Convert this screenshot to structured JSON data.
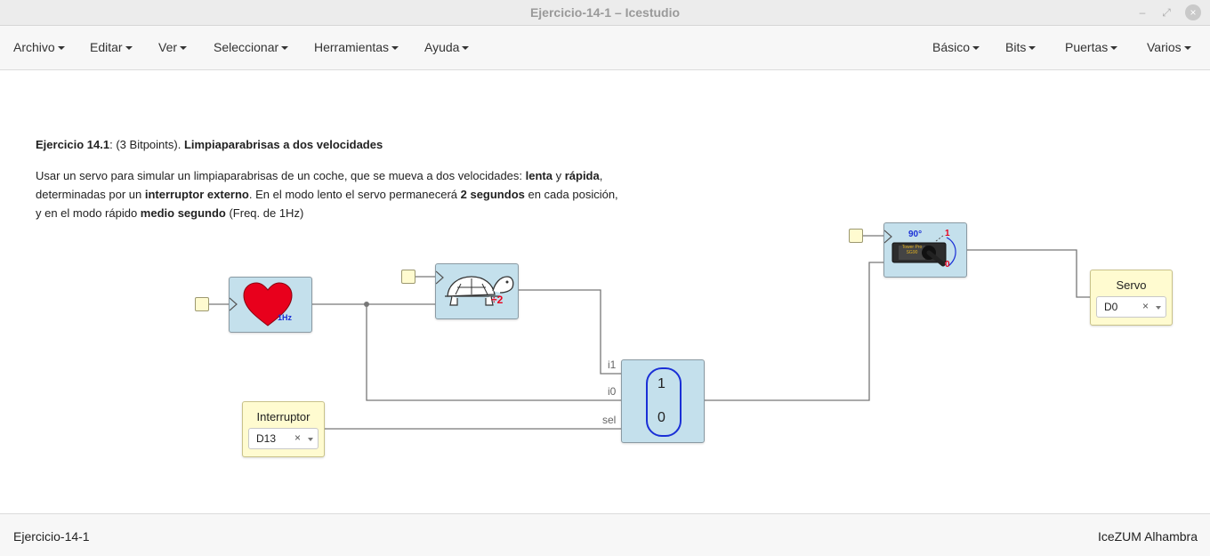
{
  "window": {
    "title": "Ejercicio-14-1 – Icestudio",
    "minimize": "–",
    "restore": "⤢",
    "close": "×"
  },
  "menus_left": [
    "Archivo",
    "Editar",
    "Ver",
    "Seleccionar",
    "Herramientas",
    "Ayuda"
  ],
  "menus_right": [
    "Básico",
    "Bits",
    "Puertas",
    "Varios"
  ],
  "description": {
    "title_bold": "Ejercicio 14.1",
    "title_mid": ": (3 Bitpoints). ",
    "title_bold2": "Limpiaparabrisas a dos velocidades",
    "p2_a": "Usar un servo para simular un limpiaparabrisas de un coche, que se mueva a dos velocidades: ",
    "p2_b": "lenta",
    "p2_c": " y ",
    "p2_d": "rápida",
    "p2_e": ", determinadas por un ",
    "p2_f": "interruptor externo",
    "p2_g": ". En el modo lento el servo permanecerá ",
    "p2_h": "2 segundos",
    "p2_i": " en cada posición, y en el modo rápido ",
    "p2_j": "medio segundo",
    "p2_k": " (Freq. de 1Hz)"
  },
  "blocks": {
    "heart": {
      "freq_label": "1Hz"
    },
    "turtle": {
      "div_label": "÷2"
    },
    "mux": {
      "in1": "i1",
      "in0": "i0",
      "sel": "sel",
      "label_1": "1",
      "label_0": "0"
    },
    "servo_block": {
      "angle": "90°",
      "mark_1": "1",
      "mark_0": "0",
      "brand": "Tower Pro SG90"
    },
    "servo_out": {
      "label": "Servo",
      "pin": "D0",
      "clear": "×"
    },
    "interruptor": {
      "label": "Interruptor",
      "pin": "D13",
      "clear": "×"
    }
  },
  "status": {
    "left": "Ejercicio-14-1",
    "right": "IceZUM Alhambra"
  },
  "colors": {
    "block_bg": "#c4e0ec",
    "io_bg": "#fffbd0",
    "wire": "#777777",
    "heart": "#e8001c",
    "mux_border": "#1a2fd6"
  }
}
